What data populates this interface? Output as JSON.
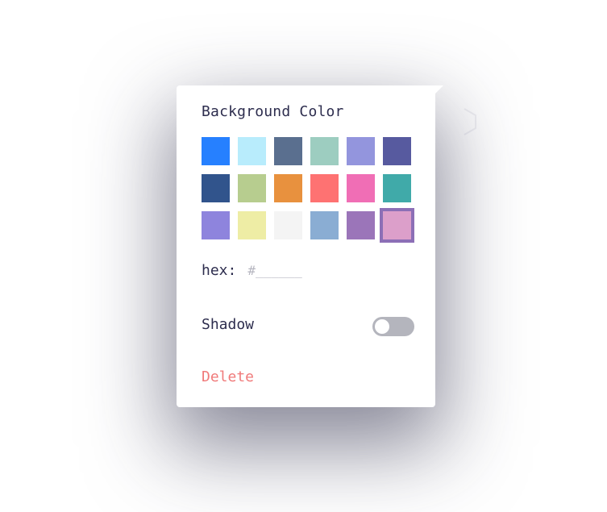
{
  "panel": {
    "title": "Background Color",
    "swatches": [
      {
        "color": "#2680ff",
        "selected": false
      },
      {
        "color": "#b8ecfc",
        "selected": false
      },
      {
        "color": "#5a6f8f",
        "selected": false
      },
      {
        "color": "#9dcdc0",
        "selected": false
      },
      {
        "color": "#9395dd",
        "selected": false
      },
      {
        "color": "#575a9f",
        "selected": false
      },
      {
        "color": "#31548c",
        "selected": false
      },
      {
        "color": "#b7cd8f",
        "selected": false
      },
      {
        "color": "#e8913e",
        "selected": false
      },
      {
        "color": "#fe7272",
        "selected": false
      },
      {
        "color": "#f06eb5",
        "selected": false
      },
      {
        "color": "#40aaa9",
        "selected": false
      },
      {
        "color": "#8e84dd",
        "selected": false
      },
      {
        "color": "#eeeda5",
        "selected": false
      },
      {
        "color": "#f4f4f4",
        "selected": false
      },
      {
        "color": "#8aadd3",
        "selected": false
      },
      {
        "color": "#9b75b9",
        "selected": false
      },
      {
        "color": "#dc9fca",
        "selected": true
      }
    ],
    "hex": {
      "label": "hex:",
      "value": "",
      "placeholder": "#______"
    },
    "shadow": {
      "label": "Shadow",
      "enabled": false
    },
    "delete_label": "Delete"
  },
  "colors": {
    "text": "#2d2d4e",
    "delete": "#f07a7a",
    "toggle_off": "#b4b5bd",
    "selected_outline": "#8c6fb6"
  }
}
